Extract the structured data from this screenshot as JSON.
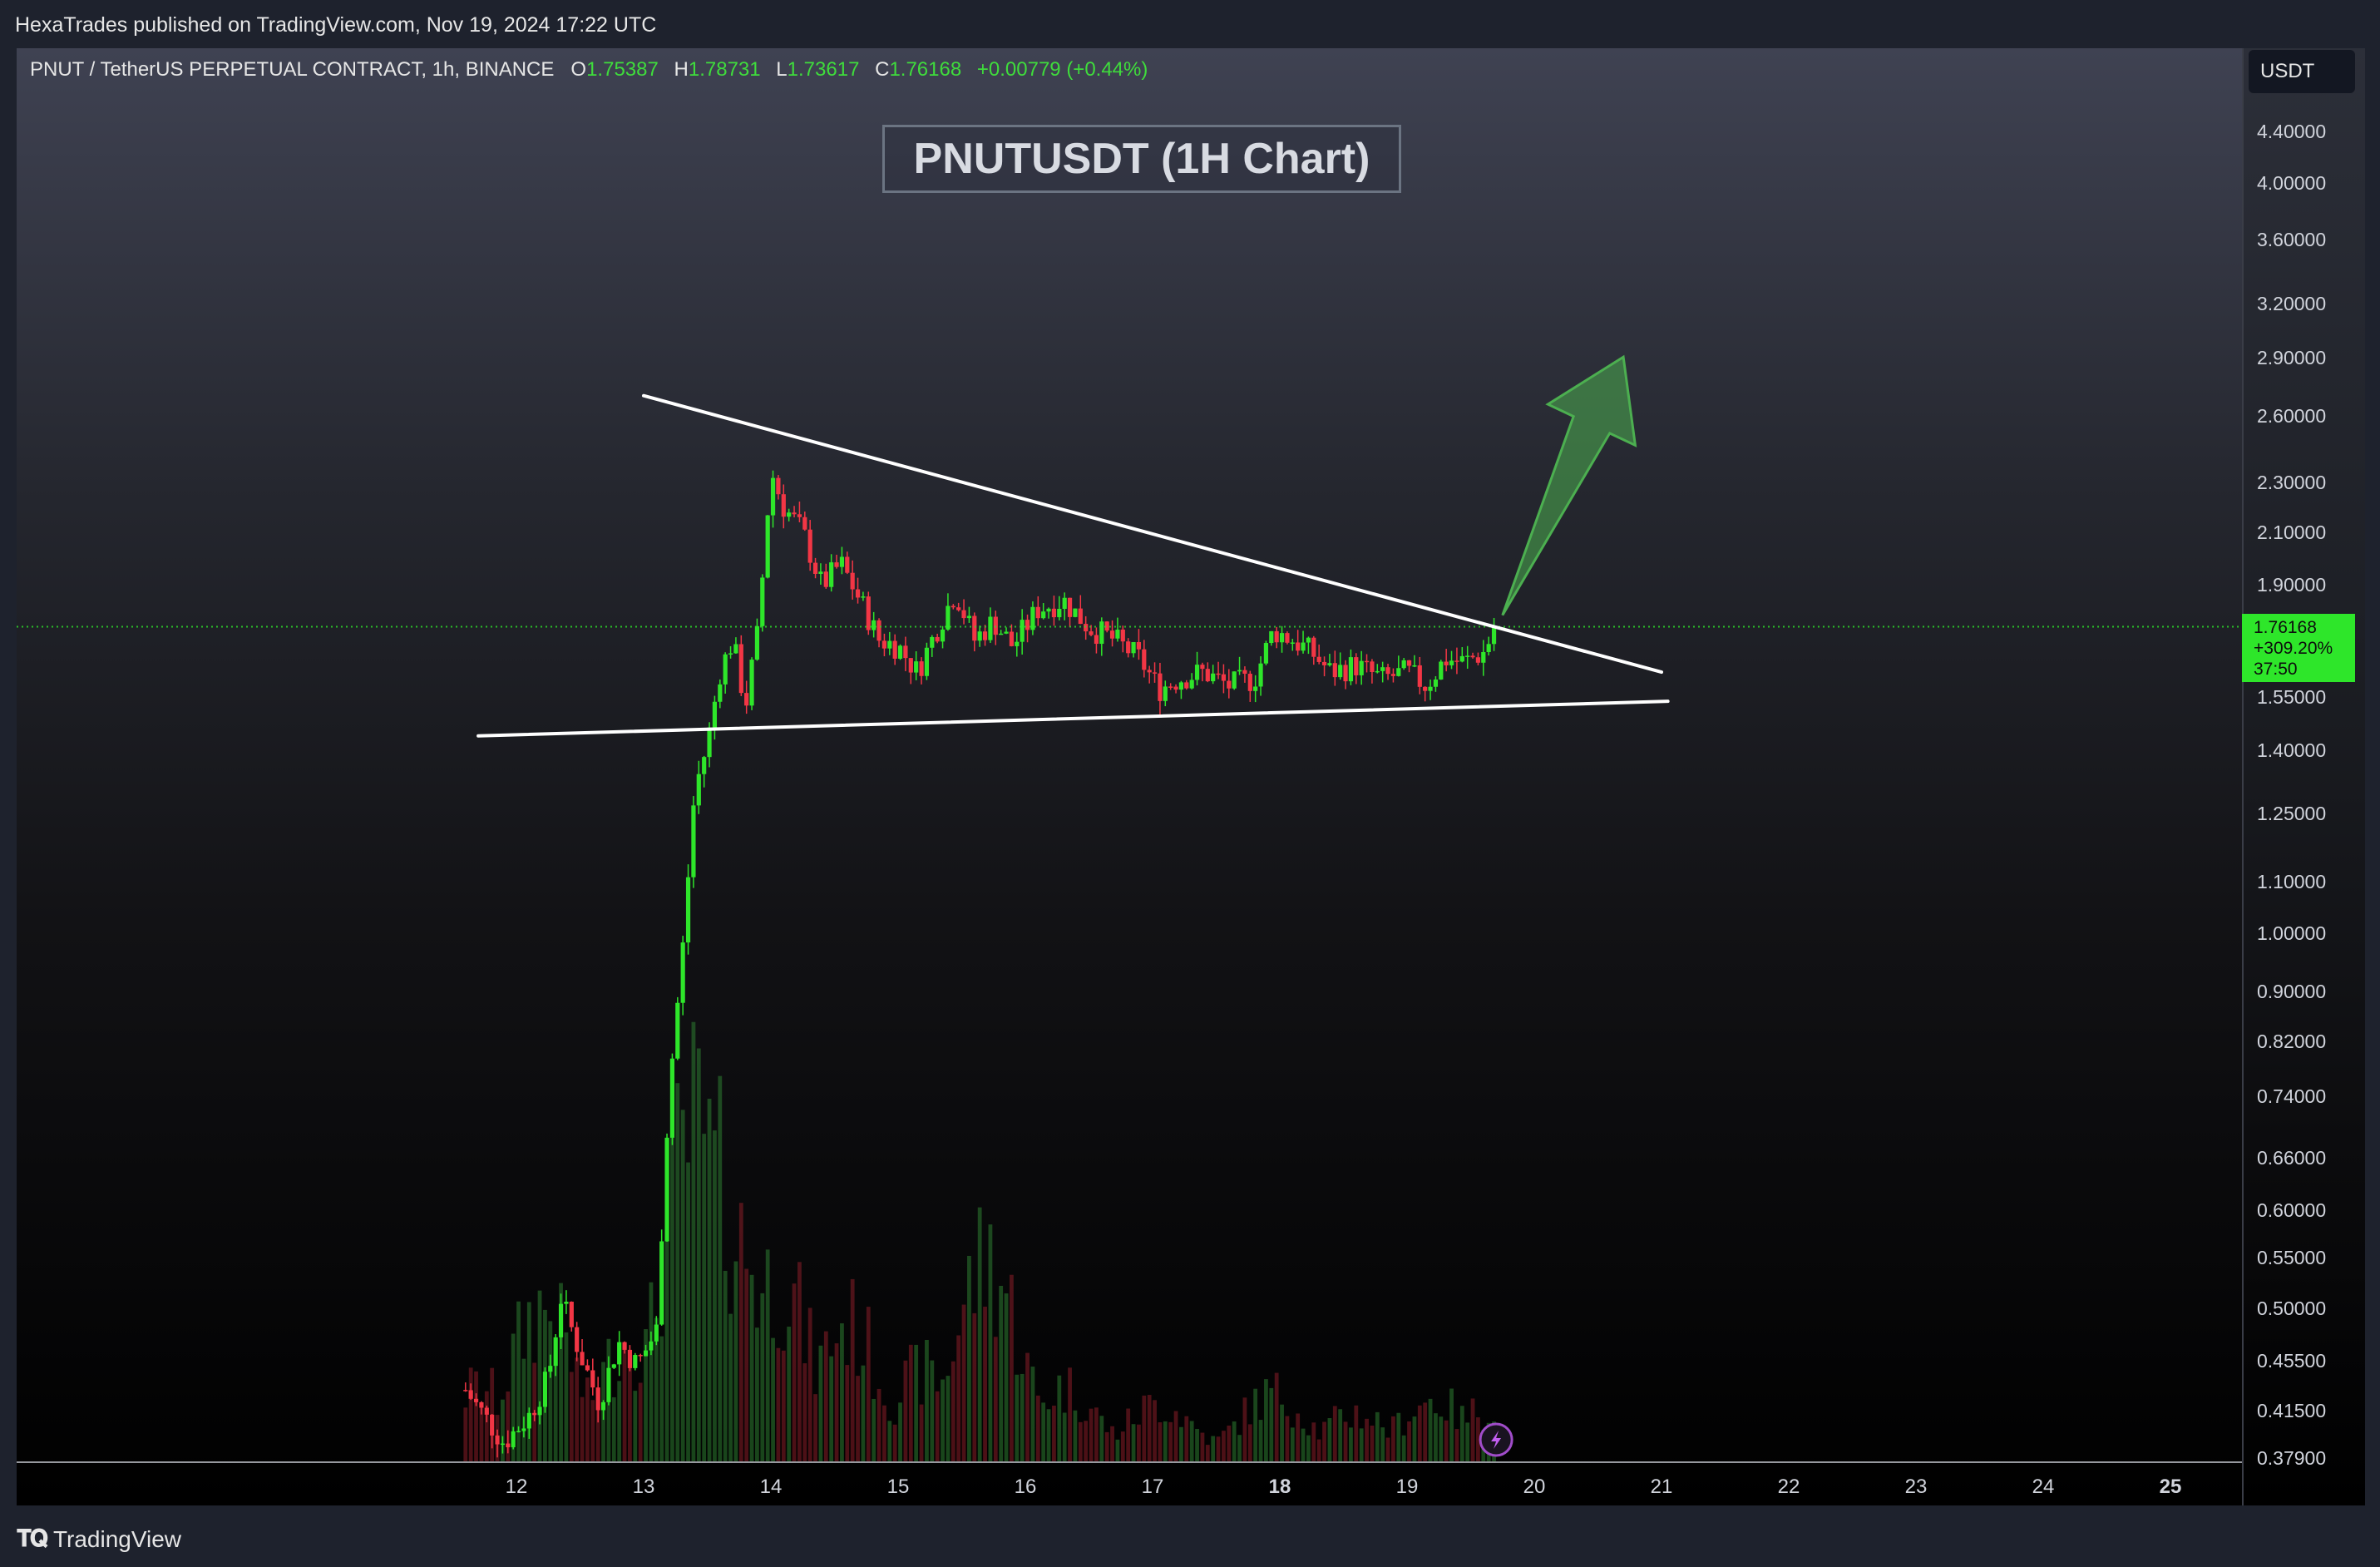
{
  "header": {
    "publish_line": "HexaTrades published on TradingView.com, Nov 19, 2024 17:22 UTC"
  },
  "legend": {
    "symbol": "PNUT / TetherUS PERPETUAL CONTRACT, 1h, BINANCE",
    "o_label": "O",
    "o_value": "1.75387",
    "h_label": "H",
    "h_value": "1.78731",
    "l_label": "L",
    "l_value": "1.73617",
    "c_label": "C",
    "c_value": "1.76168",
    "change": "+0.00779 (+0.44%)"
  },
  "currency_button": "USDT",
  "price_tag": {
    "price": "1.76168",
    "change_pct": "+309.20%",
    "countdown": "37:50"
  },
  "footer": {
    "brand": "TradingView"
  },
  "colors": {
    "up": "#2ee62a",
    "down": "#f23645",
    "arrow": "#4caf50",
    "line": "#ffffff"
  },
  "chart_data": {
    "type": "candlestick",
    "title": "PNUTUSDT (1H Chart)",
    "scale": "log",
    "ylim": [
      0.3779,
      4.7
    ],
    "y_ticks": [
      "4.40000",
      "4.00000",
      "3.60000",
      "3.20000",
      "2.90000",
      "2.60000",
      "2.30000",
      "2.10000",
      "1.90000",
      "1.55000",
      "1.40000",
      "1.25000",
      "1.10000",
      "1.00000",
      "0.90000",
      "0.82000",
      "0.74000",
      "0.66000",
      "0.60000",
      "0.55000",
      "0.50000",
      "0.45500",
      "0.41500",
      "0.37900"
    ],
    "x_ticks": [
      "12",
      "13",
      "14",
      "15",
      "16",
      "17",
      "18",
      "19",
      "20",
      "21",
      "22",
      "23",
      "24",
      "25"
    ],
    "xlim_day": [
      8.25,
      25.5
    ],
    "last_price": 1.76168,
    "price_anchors": [
      [
        11.6,
        0.43
      ],
      [
        11.9,
        0.39
      ],
      [
        12.1,
        0.41
      ],
      [
        12.25,
        0.44
      ],
      [
        12.35,
        0.51
      ],
      [
        12.5,
        0.46
      ],
      [
        12.65,
        0.42
      ],
      [
        12.8,
        0.47
      ],
      [
        12.95,
        0.45
      ],
      [
        13.1,
        0.48
      ],
      [
        13.2,
        0.75
      ],
      [
        13.3,
        0.95
      ],
      [
        13.4,
        1.3
      ],
      [
        13.5,
        1.42
      ],
      [
        13.6,
        1.62
      ],
      [
        13.7,
        1.72
      ],
      [
        13.8,
        1.52
      ],
      [
        13.9,
        1.75
      ],
      [
        14.0,
        2.35
      ],
      [
        14.1,
        2.2
      ],
      [
        14.25,
        2.1
      ],
      [
        14.4,
        1.9
      ],
      [
        14.55,
        1.98
      ],
      [
        14.7,
        1.85
      ],
      [
        14.85,
        1.72
      ],
      [
        15.0,
        1.7
      ],
      [
        15.15,
        1.62
      ],
      [
        15.3,
        1.75
      ],
      [
        15.45,
        1.88
      ],
      [
        15.6,
        1.72
      ],
      [
        15.75,
        1.78
      ],
      [
        15.9,
        1.7
      ],
      [
        16.1,
        1.82
      ],
      [
        16.3,
        1.85
      ],
      [
        16.5,
        1.76
      ],
      [
        16.7,
        1.72
      ],
      [
        16.9,
        1.66
      ],
      [
        17.05,
        1.57
      ],
      [
        17.2,
        1.6
      ],
      [
        17.4,
        1.62
      ],
      [
        17.6,
        1.58
      ],
      [
        17.8,
        1.6
      ],
      [
        17.95,
        1.75
      ],
      [
        18.1,
        1.72
      ],
      [
        18.25,
        1.68
      ],
      [
        18.4,
        1.62
      ],
      [
        18.6,
        1.64
      ],
      [
        18.8,
        1.6
      ],
      [
        19.0,
        1.62
      ],
      [
        19.15,
        1.58
      ],
      [
        19.3,
        1.66
      ],
      [
        19.45,
        1.65
      ],
      [
        19.6,
        1.68
      ],
      [
        19.7,
        1.76168
      ]
    ],
    "volume_peaks": [
      [
        11.7,
        0.2
      ],
      [
        12.2,
        0.45
      ],
      [
        12.9,
        0.35
      ],
      [
        13.4,
        1.0
      ],
      [
        13.55,
        0.85
      ],
      [
        13.75,
        0.65
      ],
      [
        14.05,
        0.55
      ],
      [
        14.6,
        0.4
      ],
      [
        15.2,
        0.25
      ],
      [
        15.7,
        0.6
      ],
      [
        16.3,
        0.2
      ],
      [
        17.05,
        0.15
      ],
      [
        17.95,
        0.18
      ],
      [
        18.6,
        0.12
      ],
      [
        19.2,
        0.16
      ],
      [
        19.65,
        0.14
      ]
    ],
    "trendlines": [
      {
        "name": "descending-resistance",
        "from": [
          13.0,
          2.7
        ],
        "to": [
          21.0,
          1.62
        ]
      },
      {
        "name": "ascending-support",
        "from": [
          11.7,
          1.44
        ],
        "to": [
          21.05,
          1.535
        ]
      }
    ],
    "arrow": {
      "from": [
        19.75,
        1.8
      ],
      "to": [
        20.7,
        2.9
      ]
    }
  }
}
